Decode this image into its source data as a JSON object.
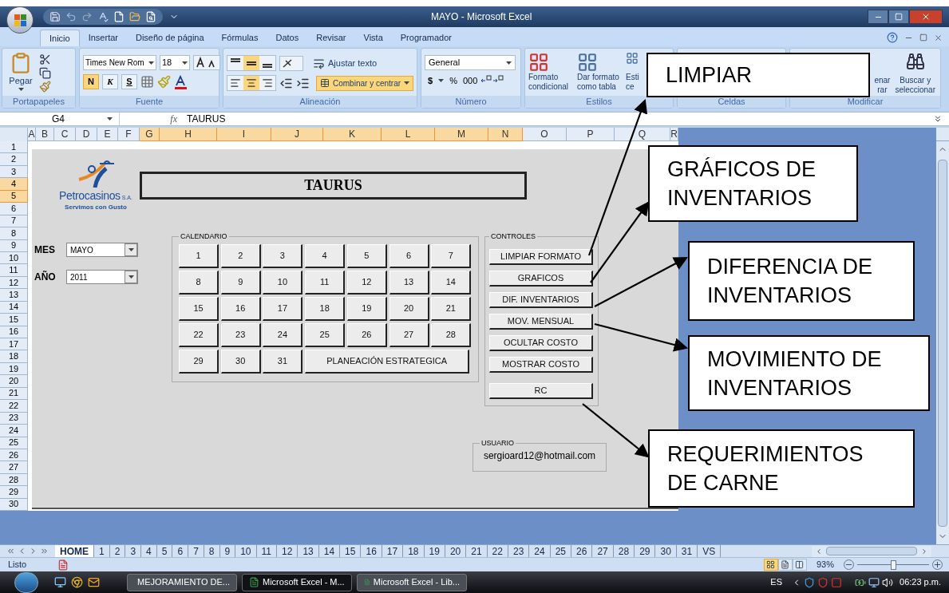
{
  "window": {
    "title": "MAYO - Microsoft Excel"
  },
  "ribbon": {
    "tabs": [
      {
        "label": "Inicio",
        "selected": true
      },
      {
        "label": "Insertar",
        "selected": false
      },
      {
        "label": "Diseño de página",
        "selected": false
      },
      {
        "label": "Fórmulas",
        "selected": false
      },
      {
        "label": "Datos",
        "selected": false
      },
      {
        "label": "Revisar",
        "selected": false
      },
      {
        "label": "Vista",
        "selected": false
      },
      {
        "label": "Programador",
        "selected": false
      }
    ],
    "clipboard": {
      "paste": "Pegar",
      "label": "Portapapeles"
    },
    "font": {
      "name": "Times New Rom",
      "size": "18",
      "bold": {
        "label": "N",
        "on": true
      },
      "italic": "K",
      "underline": "S",
      "label": "Fuente"
    },
    "alignment": {
      "vertical": [
        {
          "selected": false
        },
        {
          "selected": true
        },
        {
          "selected": false
        }
      ],
      "horizontal": [
        {
          "selected": false
        },
        {
          "selected": true
        },
        {
          "selected": false
        }
      ],
      "wrap": "Ajustar texto",
      "merge": {
        "label": "Combinar y centrar",
        "on": true
      },
      "label": "Alineación"
    },
    "number": {
      "format": "General",
      "currency": "$",
      "percent": "%",
      "thousands": "000",
      "label": "Número"
    },
    "styles": {
      "buttons": [
        {
          "lines": [
            "Formato",
            "condicional"
          ]
        },
        {
          "lines": [
            "Dar formato",
            "como tabla"
          ]
        },
        {
          "lines": [
            "Esti",
            "ce"
          ]
        }
      ],
      "label": "Estilos"
    },
    "cells": {
      "label": "Celdas"
    },
    "editing": {
      "buttons": [
        {
          "lines": [
            "enar",
            "rar"
          ]
        },
        {
          "lines": [
            "Buscar y",
            "seleccionar"
          ]
        }
      ],
      "label": "Modificar"
    }
  },
  "formula_bar": {
    "name_box": "G4",
    "function_label": "fx",
    "value": "TAURUS"
  },
  "sheet": {
    "columns": [
      {
        "label": "A",
        "selected": false
      },
      {
        "label": "B",
        "selected": false
      },
      {
        "label": "C",
        "selected": false
      },
      {
        "label": "D",
        "selected": false
      },
      {
        "label": "E",
        "selected": false
      },
      {
        "label": "F",
        "selected": false
      },
      {
        "label": "G",
        "selected": true
      },
      {
        "label": "H",
        "selected": true
      },
      {
        "label": "I",
        "selected": true
      },
      {
        "label": "J",
        "selected": true
      },
      {
        "label": "K",
        "selected": true
      },
      {
        "label": "L",
        "selected": true
      },
      {
        "label": "M",
        "selected": true
      },
      {
        "label": "N",
        "selected": true
      },
      {
        "label": "O",
        "selected": false
      },
      {
        "label": "P",
        "selected": false
      },
      {
        "label": "Q",
        "selected": false
      },
      {
        "label": "R",
        "selected": false
      }
    ],
    "rows": [
      {
        "label": "1",
        "selected": false
      },
      {
        "label": "2",
        "selected": false
      },
      {
        "label": "3",
        "selected": false
      },
      {
        "label": "4",
        "selected": true
      },
      {
        "label": "5",
        "selected": true
      },
      {
        "label": "6",
        "selected": false
      },
      {
        "label": "7",
        "selected": false
      },
      {
        "label": "8",
        "selected": false
      },
      {
        "label": "9",
        "selected": false
      },
      {
        "label": "10",
        "selected": false
      },
      {
        "label": "11",
        "selected": false
      },
      {
        "label": "12",
        "selected": false
      },
      {
        "label": "13",
        "selected": false
      },
      {
        "label": "14",
        "selected": false
      },
      {
        "label": "15",
        "selected": false
      },
      {
        "label": "16",
        "selected": false
      },
      {
        "label": "17",
        "selected": false
      },
      {
        "label": "18",
        "selected": false
      },
      {
        "label": "19",
        "selected": false
      },
      {
        "label": "20",
        "selected": false
      },
      {
        "label": "21",
        "selected": false
      },
      {
        "label": "22",
        "selected": false
      },
      {
        "label": "23",
        "selected": false
      },
      {
        "label": "24",
        "selected": false
      },
      {
        "label": "25",
        "selected": false
      },
      {
        "label": "26",
        "selected": false
      },
      {
        "label": "27",
        "selected": false
      },
      {
        "label": "28",
        "selected": false
      },
      {
        "label": "29",
        "selected": false
      },
      {
        "label": "30",
        "selected": false
      }
    ]
  },
  "form": {
    "logo": {
      "name": "Petrocasinos",
      "suffix": "S.A.",
      "slogan": "Servimos con Gusto"
    },
    "title": "TAURUS",
    "month": {
      "label": "MES",
      "value": "MAYO"
    },
    "year": {
      "label": "AÑO",
      "value": "2011"
    },
    "calendar": {
      "label": "CALENDARIO",
      "days": [
        "1",
        "2",
        "3",
        "4",
        "5",
        "6",
        "7",
        "8",
        "9",
        "10",
        "11",
        "12",
        "13",
        "14",
        "15",
        "16",
        "17",
        "18",
        "19",
        "20",
        "21",
        "22",
        "23",
        "24",
        "25",
        "26",
        "27",
        "28",
        "29",
        "30",
        "31"
      ],
      "extra": "PLANEACIÓN ESTRATEGICA"
    },
    "controls": {
      "label": "CONTROLES",
      "buttons": [
        "LIMPIAR FORMATO",
        "GRAFICOS",
        "DIF. INVENTARIOS",
        "MOV. MENSUAL",
        "OCULTAR COSTO",
        "MOSTRAR COSTO",
        "RC"
      ]
    },
    "user": {
      "label": "USUARIO",
      "email": "sergioard12@hotmail.com"
    }
  },
  "callouts": [
    {
      "text": "LIMPIAR"
    },
    {
      "text": "GRÁFICOS DE INVENTARIOS"
    },
    {
      "text": "DIFERENCIA DE INVENTARIOS"
    },
    {
      "text": "MOVIMIENTO DE INVENTARIOS"
    },
    {
      "text": "REQUERIMIENTOS DE CARNE"
    }
  ],
  "sheet_tabs": [
    {
      "label": "HOME",
      "selected": true
    },
    {
      "label": "1",
      "selected": false
    },
    {
      "label": "2",
      "selected": false
    },
    {
      "label": "3",
      "selected": false
    },
    {
      "label": "4",
      "selected": false
    },
    {
      "label": "5",
      "selected": false
    },
    {
      "label": "6",
      "selected": false
    },
    {
      "label": "7",
      "selected": false
    },
    {
      "label": "8",
      "selected": false
    },
    {
      "label": "9",
      "selected": false
    },
    {
      "label": "10",
      "selected": false
    },
    {
      "label": "11",
      "selected": false
    },
    {
      "label": "12",
      "selected": false
    },
    {
      "label": "13",
      "selected": false
    },
    {
      "label": "14",
      "selected": false
    },
    {
      "label": "15",
      "selected": false
    },
    {
      "label": "16",
      "selected": false
    },
    {
      "label": "17",
      "selected": false
    },
    {
      "label": "18",
      "selected": false
    },
    {
      "label": "19",
      "selected": false
    },
    {
      "label": "20",
      "selected": false
    },
    {
      "label": "21",
      "selected": false
    },
    {
      "label": "22",
      "selected": false
    },
    {
      "label": "23",
      "selected": false
    },
    {
      "label": "24",
      "selected": false
    },
    {
      "label": "25",
      "selected": false
    },
    {
      "label": "26",
      "selected": false
    },
    {
      "label": "27",
      "selected": false
    },
    {
      "label": "28",
      "selected": false
    },
    {
      "label": "29",
      "selected": false
    },
    {
      "label": "30",
      "selected": false
    },
    {
      "label": "31",
      "selected": false
    },
    {
      "label": "VS",
      "selected": false
    }
  ],
  "status_bar": {
    "status": "Listo",
    "views": [
      {
        "selected": true
      },
      {
        "selected": false
      },
      {
        "selected": false
      }
    ],
    "zoom": "93%",
    "zoom_slider": {
      "level": 0.5
    }
  },
  "taskbar": {
    "tasks": [
      {
        "label": "MEJORAMIENTO DE...",
        "selected": false
      },
      {
        "label": "Microsoft Excel - M...",
        "selected": true
      },
      {
        "label": "Microsoft Excel - Lib...",
        "selected": false
      }
    ],
    "language": "ES",
    "clock": "06:23 p.m."
  }
}
